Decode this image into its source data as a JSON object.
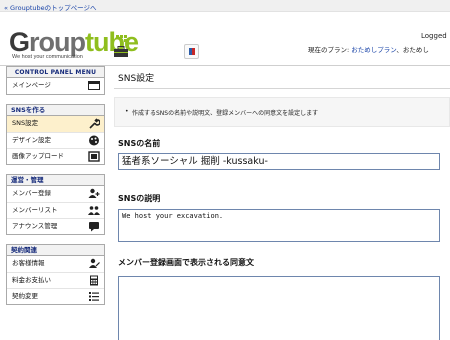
{
  "topbar": {
    "link": "« Grouptubeのトップページへ"
  },
  "header": {
    "logo_text": {
      "g": "G",
      "mid": "roup",
      "tail": "tube"
    },
    "tagline": "We host your communication",
    "logged": "Logged",
    "plan_prefix": "現在のプラン: ",
    "plan_link": "おためしプラン",
    "plan_suffix": "、おためし",
    "colors": {
      "logo_green": "#8fbe1e",
      "link_blue": "#1a44a8"
    }
  },
  "sidebar": {
    "control_panel": {
      "title": "CONTROL PANEL MENU",
      "items": [
        {
          "label": "メインページ",
          "icon": "main-page-icon"
        }
      ]
    },
    "sns": {
      "title": "SNSを作る",
      "items": [
        {
          "label": "SNS設定",
          "icon": "wrench-icon",
          "active": true
        },
        {
          "label": "デザイン設定",
          "icon": "palette-icon"
        },
        {
          "label": "画像アップロード",
          "icon": "image-frame-icon"
        }
      ]
    },
    "operation": {
      "title": "運営・管理",
      "items": [
        {
          "label": "メンバー登録",
          "icon": "add-user-icon"
        },
        {
          "label": "メンバーリスト",
          "icon": "users-icon"
        },
        {
          "label": "アナウンス管理",
          "icon": "announce-icon"
        }
      ]
    },
    "contract": {
      "title": "契約関連",
      "items": [
        {
          "label": "お客様情報",
          "icon": "customer-icon"
        },
        {
          "label": "料金お支払い",
          "icon": "calculator-icon"
        },
        {
          "label": "契約変更",
          "icon": "list-icon"
        }
      ]
    }
  },
  "main": {
    "page_title": "SNS設定",
    "notice": "作成するSNSの名前や説明文、登録メンバーへの同意文を設定します",
    "sns_name": {
      "label": "SNSの名前",
      "value": "猛者系ソーシャル 掘削 -kussaku-"
    },
    "sns_description": {
      "label": "SNSの説明",
      "value": "We host your excavation."
    },
    "agreement": {
      "label": "メンバー登録画面で表示される同意文",
      "value": ""
    }
  }
}
